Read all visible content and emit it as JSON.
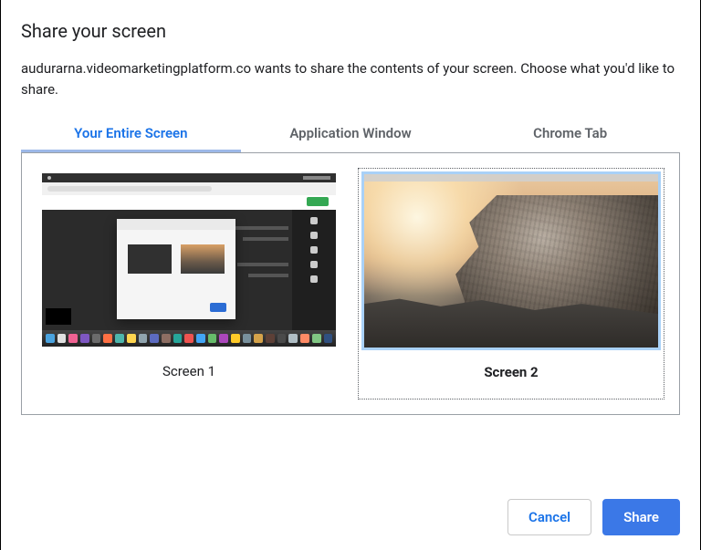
{
  "dialog": {
    "title": "Share your screen",
    "description": "audurarna.videomarketingplatform.co wants to share the contents of your screen. Choose what you'd like to share."
  },
  "tabs": {
    "entire_screen": "Your Entire Screen",
    "app_window": "Application Window",
    "chrome_tab": "Chrome Tab",
    "active": "entire_screen"
  },
  "screens": {
    "screen1_label": "Screen 1",
    "screen2_label": "Screen 2",
    "selected": "screen2"
  },
  "buttons": {
    "cancel": "Cancel",
    "share": "Share"
  },
  "dock_colors": [
    "#4aa3df",
    "#e0e0e0",
    "#f06292",
    "#7e57c2",
    "#6b6b6b",
    "#ff7043",
    "#4db6ac",
    "#ffd54f",
    "#90a4ae",
    "#5c6bc0",
    "#8d6e63",
    "#26a69a",
    "#ef5350",
    "#42a5f5",
    "#66bb6a",
    "#ab47bc",
    "#ffca28",
    "#78909c",
    "#d4a24a",
    "#5d4037",
    "#4a4a4a",
    "#b0bec5",
    "#ff8a65",
    "#81c784",
    "#305080"
  ]
}
